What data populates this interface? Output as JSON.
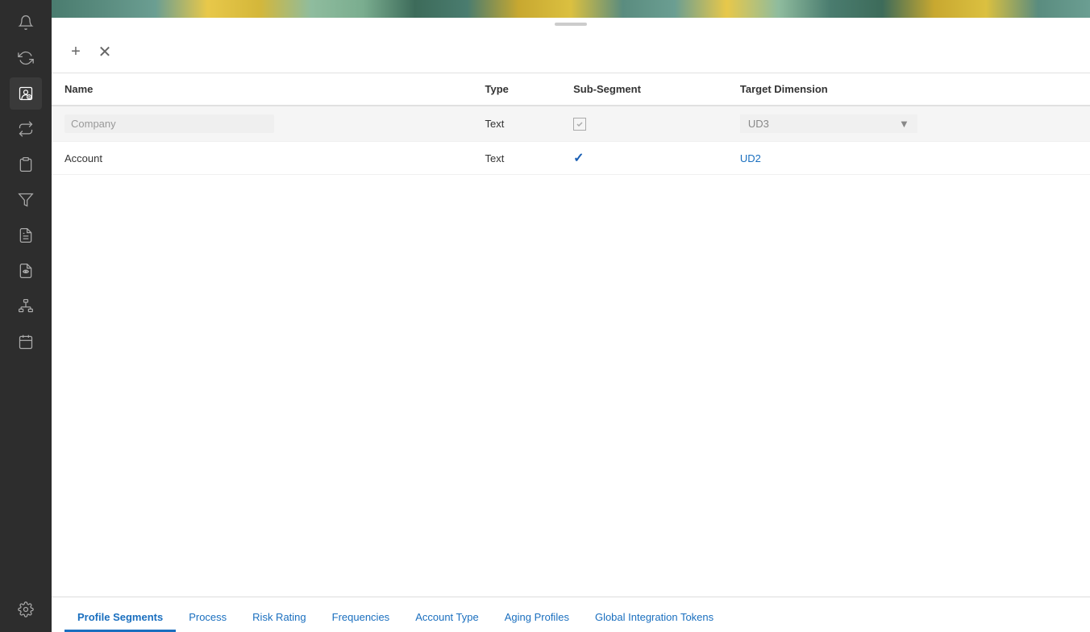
{
  "sidebar": {
    "icons": [
      {
        "name": "bell-icon",
        "symbol": "🔔"
      },
      {
        "name": "sync-icon",
        "symbol": "↻"
      },
      {
        "name": "profile-settings-icon",
        "symbol": "⊙",
        "active": true
      },
      {
        "name": "transfer-icon",
        "symbol": "⇄"
      },
      {
        "name": "document-icon",
        "symbol": "📋"
      },
      {
        "name": "filter-icon",
        "symbol": "⊿"
      },
      {
        "name": "report-icon",
        "symbol": "📄"
      },
      {
        "name": "monitor-icon",
        "symbol": "🖥"
      },
      {
        "name": "hierarchy-icon",
        "symbol": "⊞"
      },
      {
        "name": "calendar-icon",
        "symbol": "📅"
      },
      {
        "name": "settings-icon",
        "symbol": "⚙"
      }
    ]
  },
  "toolbar": {
    "add_label": "+",
    "remove_label": "✕"
  },
  "table": {
    "headers": [
      "Name",
      "Type",
      "Sub-Segment",
      "Target Dimension"
    ],
    "rows": [
      {
        "name": "Company",
        "name_placeholder": "Company",
        "type": "Text",
        "sub_segment": "disabled_checkbox",
        "target_dimension": "UD3",
        "selected": true
      },
      {
        "name": "Account",
        "type": "Text",
        "sub_segment": "checked",
        "target_dimension": "UD2",
        "selected": false
      }
    ]
  },
  "bottom_tabs": {
    "items": [
      {
        "label": "Profile Segments",
        "active": true
      },
      {
        "label": "Process",
        "active": false
      },
      {
        "label": "Risk Rating",
        "active": false
      },
      {
        "label": "Frequencies",
        "active": false
      },
      {
        "label": "Account Type",
        "active": false
      },
      {
        "label": "Aging Profiles",
        "active": false
      },
      {
        "label": "Global Integration Tokens",
        "active": false
      }
    ]
  }
}
